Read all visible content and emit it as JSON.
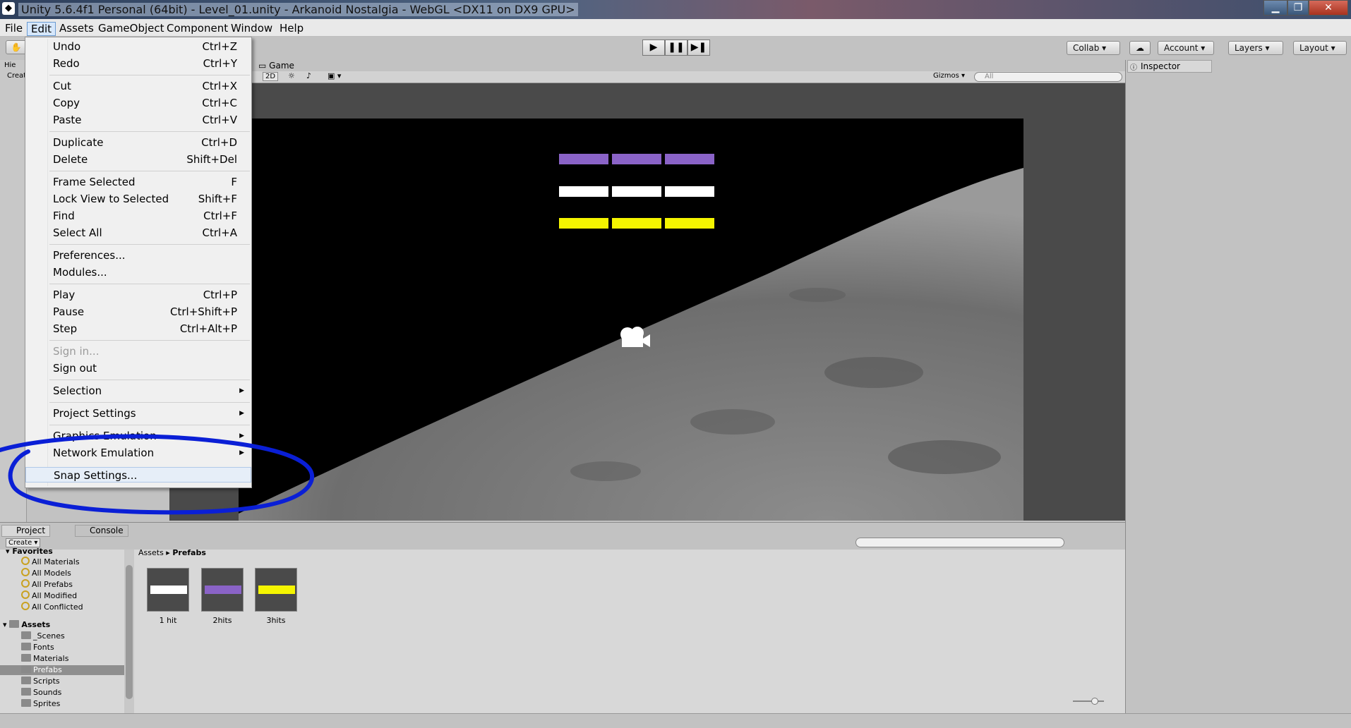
{
  "window": {
    "title": "Unity 5.6.4f1 Personal (64bit) - Level_01.unity - Arkanoid Nostalgia - WebGL <DX11 on DX9 GPU>",
    "controls": [
      "▁",
      "❐",
      "✕"
    ]
  },
  "menubar": [
    "File",
    "Edit",
    "Assets",
    "GameObject",
    "Component",
    "Window",
    "Help"
  ],
  "toolbar": {
    "play": "▶",
    "pause": "❚❚",
    "step": "▶❚",
    "collab": "Collab ▾",
    "account": "Account",
    "layers": "Layers",
    "layout": "Layout"
  },
  "hierarchy": {
    "tab": "Hie",
    "create": "Creat"
  },
  "game": {
    "tab": "Game",
    "mode": "2D",
    "gizmos": "Gizmos ▾",
    "search": "All"
  },
  "colors": {
    "purple": "#8A63C7",
    "white": "#FFFFFF",
    "yellow": "#F5F500"
  },
  "inspector": {
    "tab": "Inspector"
  },
  "project": {
    "tab_project": "Project",
    "tab_console": "Console",
    "create": "Create ▾",
    "favorites_header": "Favorites",
    "favorites": [
      "All Materials",
      "All Models",
      "All Prefabs",
      "All Modified",
      "All Conflicted"
    ],
    "assets_header": "Assets",
    "folders": [
      "_Scenes",
      "Fonts",
      "Materials",
      "Prefabs",
      "Scripts",
      "Sounds",
      "Sprites"
    ],
    "breadcrumb": [
      "Assets",
      "Prefabs"
    ],
    "items": [
      {
        "label": "1 hit",
        "color": "#FFFFFF"
      },
      {
        "label": "2hits",
        "color": "#8A63C7"
      },
      {
        "label": "3hits",
        "color": "#F5F500"
      }
    ]
  },
  "edit_menu": {
    "items": [
      {
        "label": "Undo",
        "shortcut": "Ctrl+Z"
      },
      {
        "label": "Redo",
        "shortcut": "Ctrl+Y"
      },
      {
        "label": "Cut",
        "shortcut": "Ctrl+X"
      },
      {
        "label": "Copy",
        "shortcut": "Ctrl+C"
      },
      {
        "label": "Paste",
        "shortcut": "Ctrl+V"
      },
      {
        "label": "Duplicate",
        "shortcut": "Ctrl+D"
      },
      {
        "label": "Delete",
        "shortcut": "Shift+Del"
      },
      {
        "label": "Frame Selected",
        "shortcut": "F"
      },
      {
        "label": "Lock View to Selected",
        "shortcut": "Shift+F"
      },
      {
        "label": "Find",
        "shortcut": "Ctrl+F"
      },
      {
        "label": "Select All",
        "shortcut": "Ctrl+A"
      },
      {
        "label": "Preferences..."
      },
      {
        "label": "Modules..."
      },
      {
        "label": "Play",
        "shortcut": "Ctrl+P"
      },
      {
        "label": "Pause",
        "shortcut": "Ctrl+Shift+P"
      },
      {
        "label": "Step",
        "shortcut": "Ctrl+Alt+P"
      },
      {
        "label": "Sign in..."
      },
      {
        "label": "Sign out"
      },
      {
        "label": "Selection"
      },
      {
        "label": "Project Settings"
      },
      {
        "label": "Graphics Emulation"
      },
      {
        "label": "Network Emulation"
      },
      {
        "label": "Snap Settings..."
      }
    ]
  }
}
